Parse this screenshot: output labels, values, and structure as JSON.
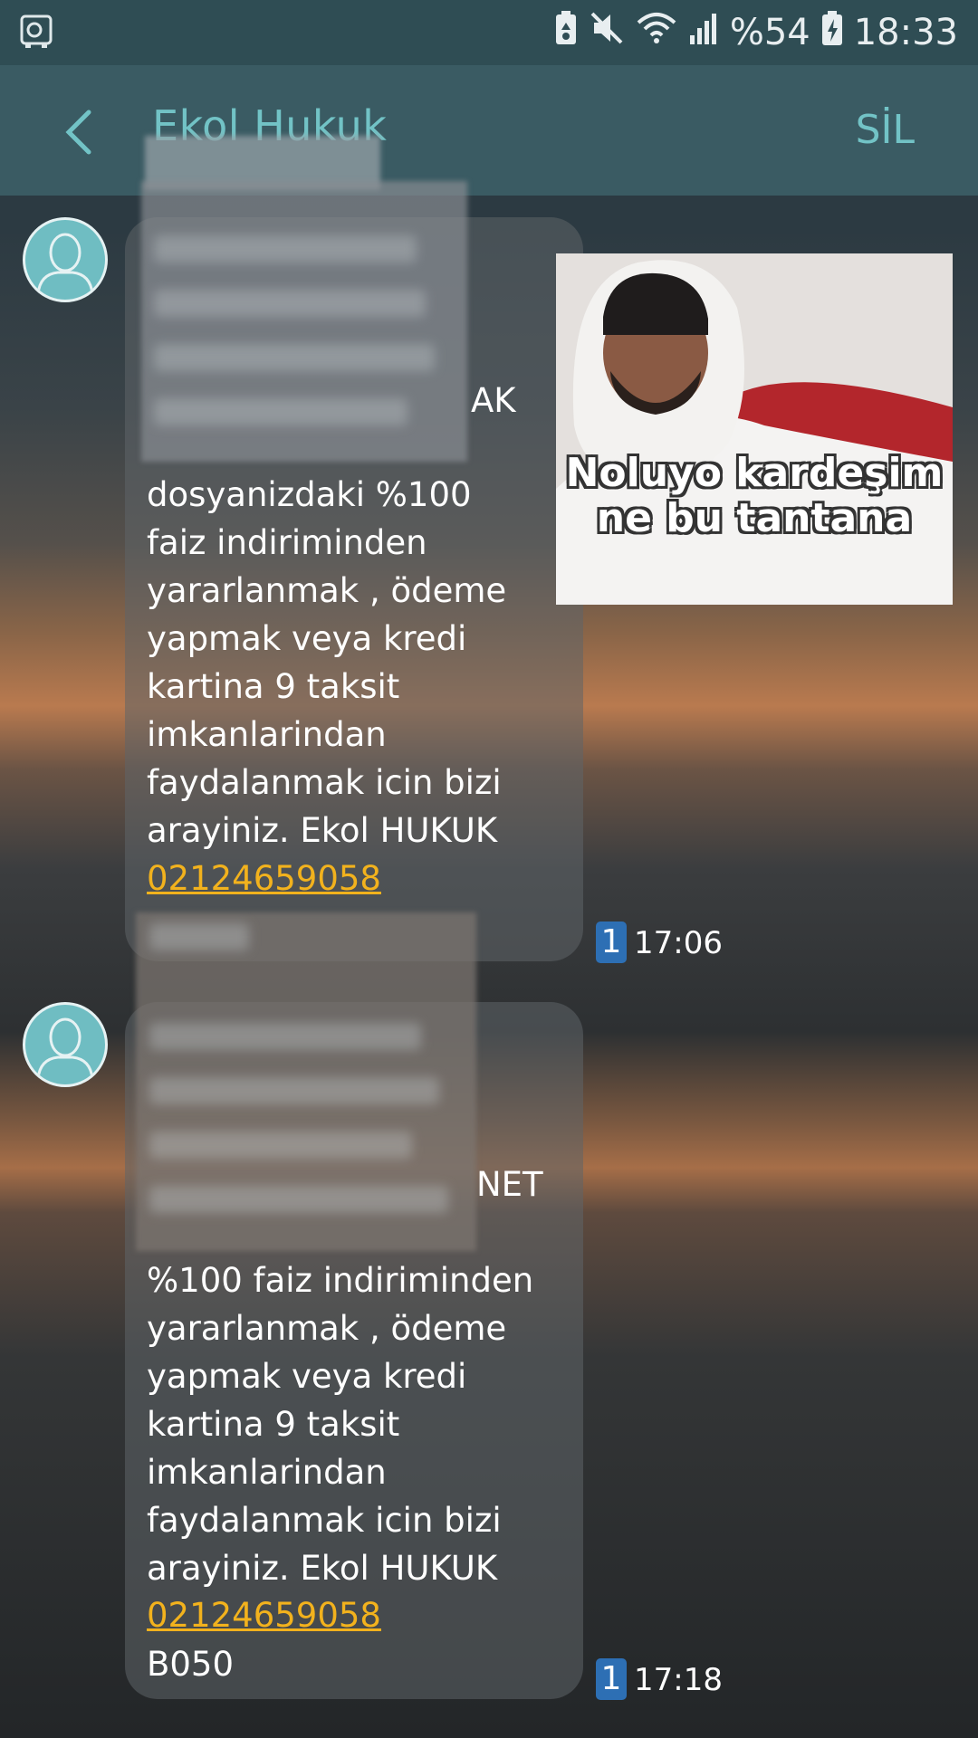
{
  "status_bar": {
    "battery_percent": "%54",
    "time": "18:33"
  },
  "app_bar": {
    "title": "Ekol Hukuk",
    "delete_label": "SİL"
  },
  "messages": [
    {
      "partial_text": "AK",
      "text": "dosyanizdaki %100\nfaiz indiriminden\nyararlanmak , ödeme\nyapmak veya kredi\nkartina 9 taksit\nimkanlarindan\nfaydalanmak icin bizi\narayiniz. Ekol HUKUK",
      "phone": "02124659058",
      "sim": "1",
      "time": "17:06"
    },
    {
      "partial_text": "NET",
      "text": "%100 faiz indiriminden\nyararlanmak , ödeme\nyapmak veya kredi\nkartina 9 taksit\nimkanlarindan\nfaydalanmak icin bizi\narayiniz. Ekol HUKUK",
      "phone": "02124659058",
      "suffix": "B050",
      "sim": "1",
      "time": "17:18"
    }
  ],
  "sticker": {
    "caption_line1": "Noluyo kardeşim",
    "caption_line2": "ne bu tantana"
  }
}
